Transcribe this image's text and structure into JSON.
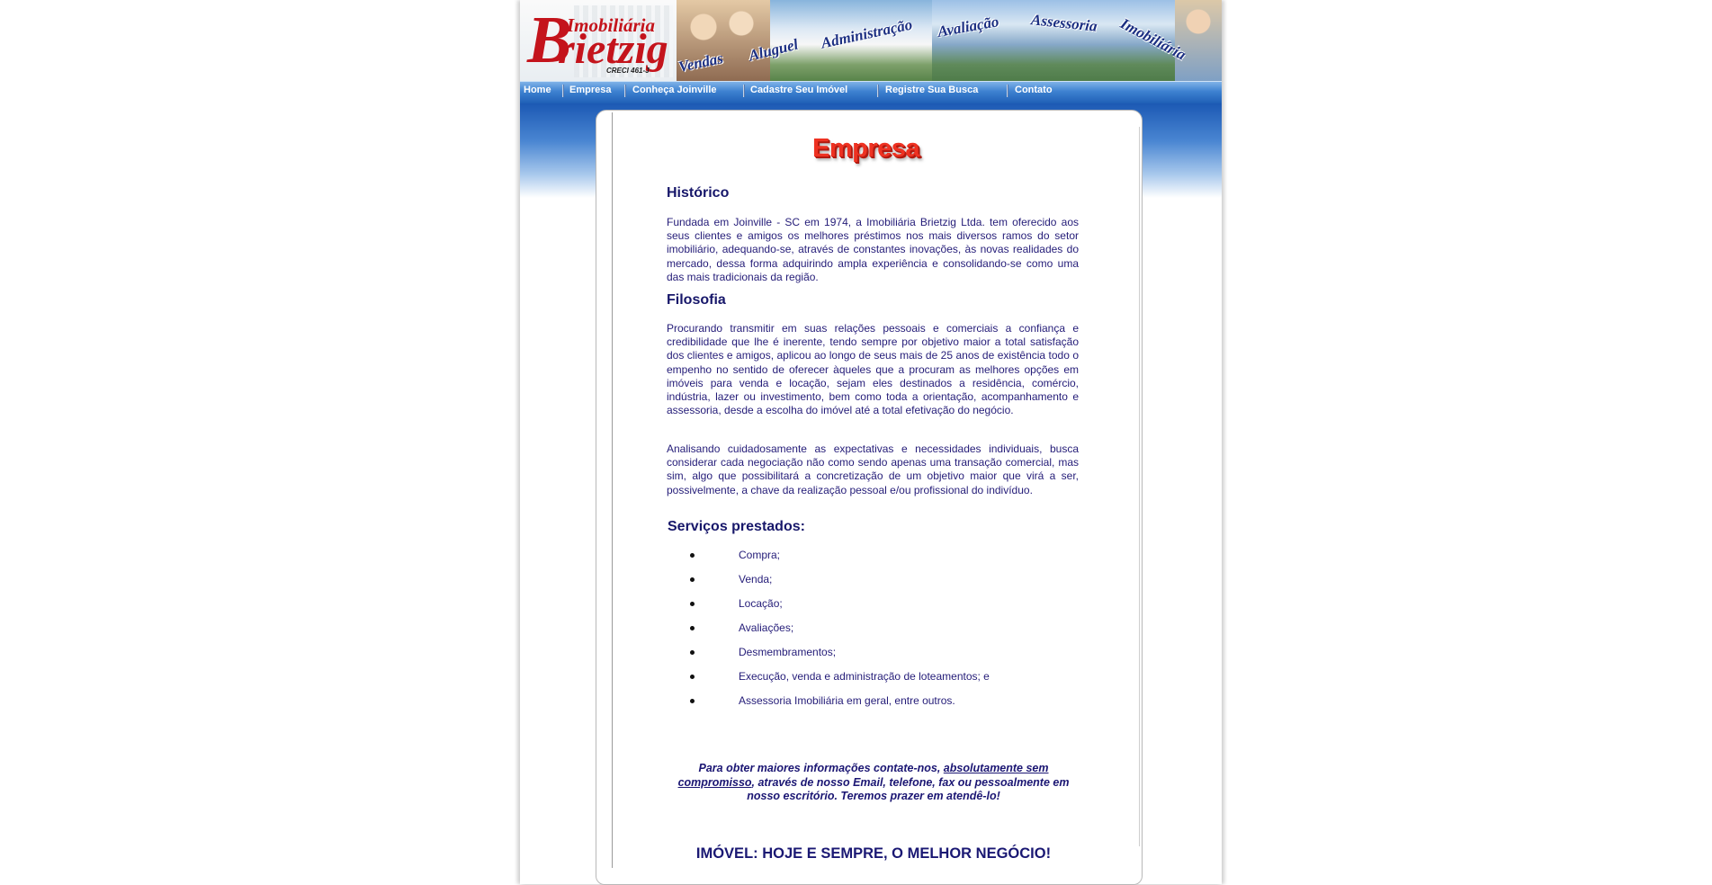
{
  "header": {
    "logo": {
      "line1": "Imobiliária",
      "brand_initial": "B",
      "brand_rest": "rietzig",
      "creci": "CRECI 461-J"
    },
    "banner_words": [
      "Vendas",
      "Aluguel",
      "Administração",
      "Avaliação",
      "Assessoria",
      "Imobiliária"
    ]
  },
  "nav": {
    "items": [
      {
        "label": "Home"
      },
      {
        "label": "Empresa"
      },
      {
        "label": "Conheça Joinville"
      },
      {
        "label": "Cadastre Seu Imóvel"
      },
      {
        "label": "Registre Sua Busca"
      },
      {
        "label": "Contato"
      }
    ]
  },
  "main": {
    "title": "Empresa",
    "historico": {
      "heading": "Histórico",
      "text": "Fundada em Joinville - SC em 1974, a Imobiliária Brietzig Ltda. tem oferecido aos seus clientes e amigos os melhores préstimos nos mais diversos ramos do setor imobiliário, adequando-se, através de constantes inovações, às novas realidades do mercado, dessa forma adquirindo ampla experiência e consolidando-se como uma das mais tradicionais da região."
    },
    "filosofia": {
      "heading": "Filosofia",
      "text1": "Procurando transmitir em suas relações pessoais e comerciais a confiança e credibilidade que lhe é inerente, tendo sempre por objetivo maior a total satisfação dos clientes e amigos, aplicou ao longo de seus mais de 25 anos de existência todo o empenho no sentido de oferecer àqueles que a procuram as melhores opções em imóveis para venda e locação, sejam eles destinados a residência, comércio, indústria, lazer ou investimento, bem como toda a orientação, acompanhamento e assessoria, desde a escolha do imóvel até a total efetivação do negócio.",
      "text2": "Analisando cuidadosamente as expectativas e necessidades individuais, busca considerar cada negociação não como sendo apenas uma transação comercial, mas sim, algo que possibilitará a concretização de um objetivo maior que virá a ser, possivelmente, a chave da realização pessoal e/ou profissional do indivíduo."
    },
    "servicos": {
      "heading": "Serviços prestados:",
      "items": [
        "Compra;",
        "Venda;",
        "Locação;",
        "Avaliações;",
        "Desmembramentos;",
        "Execução, venda e administração de loteamentos; e",
        "Assessoria Imobiliária em geral, entre outros."
      ]
    },
    "contact": {
      "before": "Para obter maiores informações contate-nos, ",
      "link": "absolutamente sem compromisso",
      "after": ", através de nosso Email, telefone, fax ou pessoalmente em nosso escritório. Teremos prazer em atendê-lo!"
    },
    "slogan": "IMÓVEL: HOJE E SEMPRE, O MELHOR NEGÓCIO!"
  }
}
